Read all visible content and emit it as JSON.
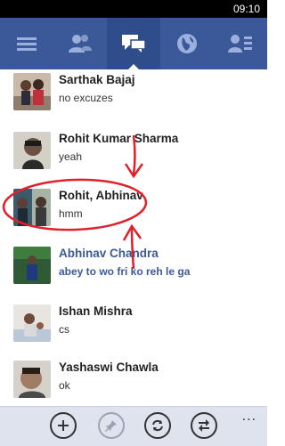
{
  "statusbar": {
    "time": "09:10"
  },
  "nav": {
    "items": [
      {
        "icon": "menu-icon",
        "active": false
      },
      {
        "icon": "friends-icon",
        "active": false
      },
      {
        "icon": "messages-icon",
        "active": true
      },
      {
        "icon": "globe-icon",
        "active": false
      },
      {
        "icon": "contacts-icon",
        "active": false
      }
    ]
  },
  "conversations": [
    {
      "name": "Sarthak Bajaj",
      "message": "no excuzes",
      "unread": false
    },
    {
      "name": "Rohit Kumar Sharma",
      "message": "yeah",
      "unread": false
    },
    {
      "name": "Rohit, Abhinav",
      "message": "hmm",
      "unread": false
    },
    {
      "name": "Abhinav Chandra",
      "message": "abey to wo fri ko reh le ga",
      "unread": true
    },
    {
      "name": "Ishan Mishra",
      "message": "cs",
      "unread": false
    },
    {
      "name": "Yashaswi Chawla",
      "message": "ok",
      "unread": false
    }
  ],
  "appbar": {
    "buttons": [
      {
        "icon": "add-icon",
        "enabled": true
      },
      {
        "icon": "pin-icon",
        "enabled": false
      },
      {
        "icon": "refresh-icon",
        "enabled": true
      },
      {
        "icon": "switch-icon",
        "enabled": true
      }
    ],
    "more": "..."
  },
  "colors": {
    "nav": "#3b5998",
    "accent_link": "#3b5998",
    "annotation": "#e0202a"
  }
}
